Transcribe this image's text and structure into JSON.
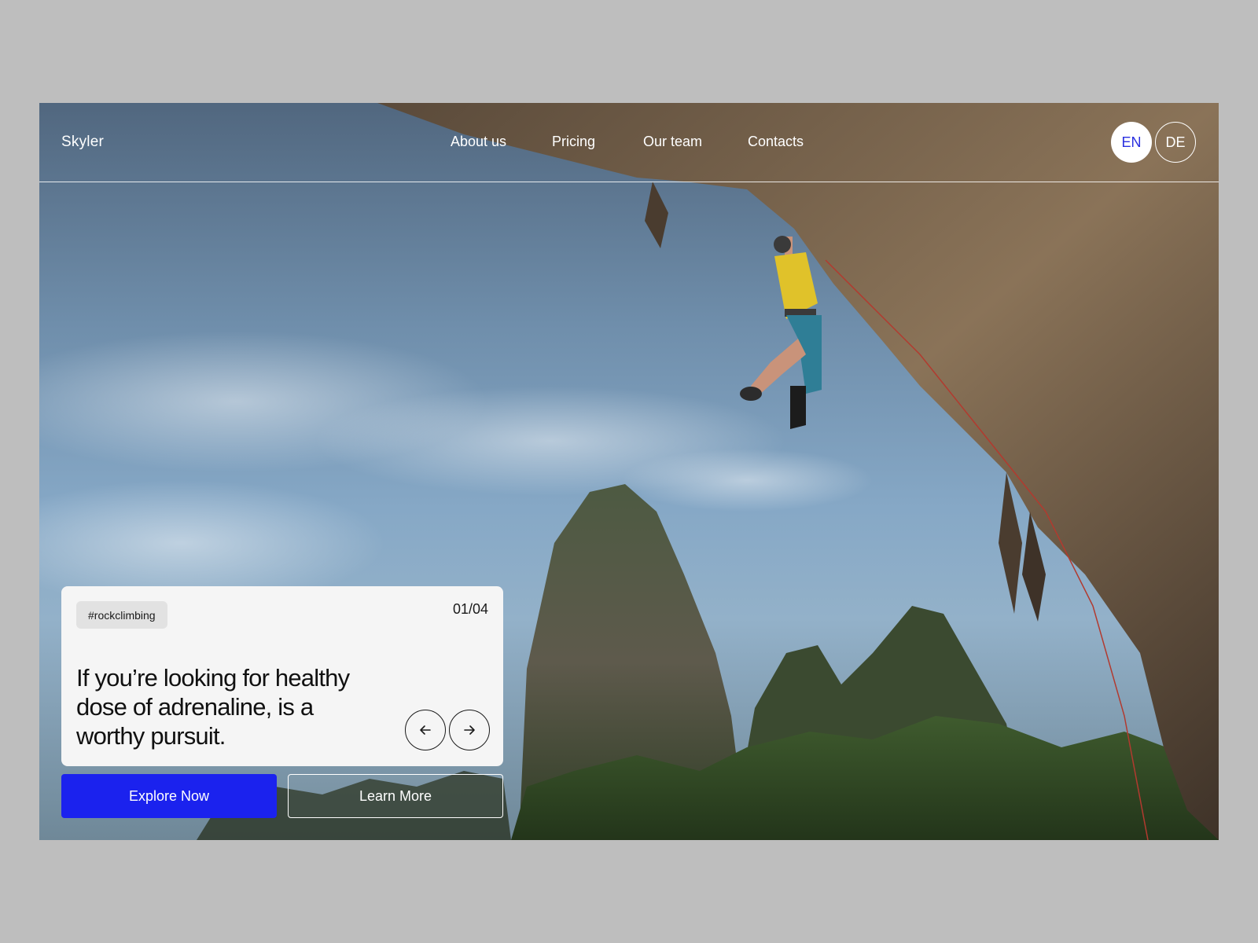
{
  "brand": {
    "name": "Skyler"
  },
  "nav": {
    "links": [
      {
        "label": "About us"
      },
      {
        "label": "Pricing"
      },
      {
        "label": "Our team"
      },
      {
        "label": "Contacts"
      }
    ]
  },
  "languages": {
    "active": "EN",
    "items": [
      {
        "label": "EN"
      },
      {
        "label": "DE"
      }
    ]
  },
  "card": {
    "tag": "#rockclimbing",
    "counter": "01/04",
    "headline": "If you’re looking for healthy dose of adrenaline, is a worthy pursuit."
  },
  "cta": {
    "primary_label": "Explore Now",
    "secondary_label": "Learn More"
  },
  "colors": {
    "accent": "#1b22ee",
    "page_background": "#bebebe",
    "card_background": "#f5f5f5"
  },
  "icons": {
    "prev": "arrow-left-icon",
    "next": "arrow-right-icon"
  }
}
